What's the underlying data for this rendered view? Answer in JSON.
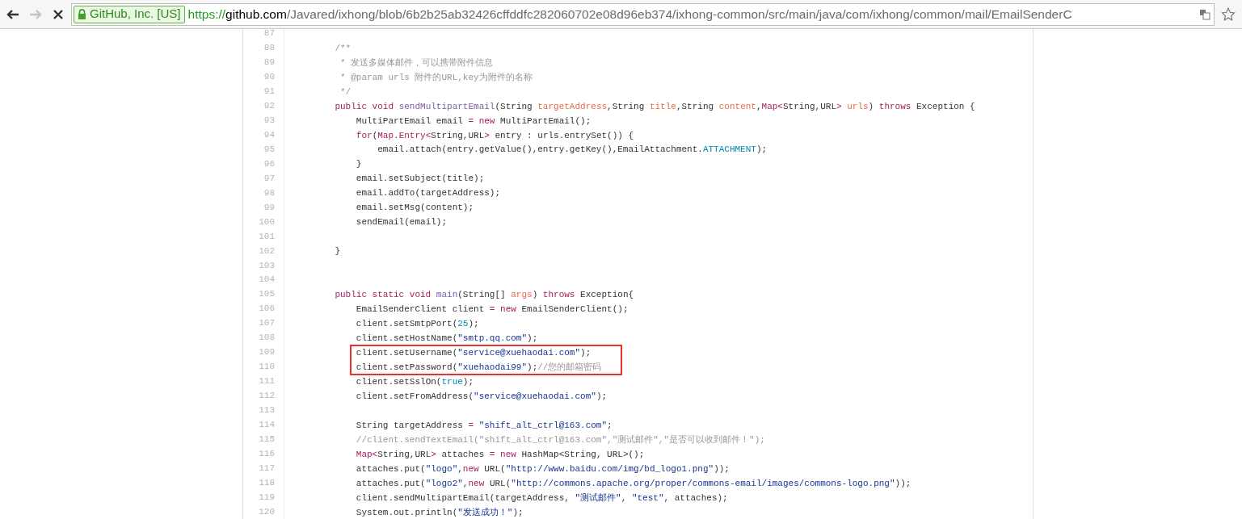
{
  "browser": {
    "back_disabled": false,
    "forward_disabled": true,
    "security_label": "GitHub, Inc. [US]",
    "url": [
      {
        "kind": "scheme",
        "text": "https://"
      },
      {
        "kind": "host",
        "text": "github.com"
      },
      {
        "kind": "path",
        "text": "/Javared/ixhong/blob/6b2b25ab32426cffddfc282060702e08d96eb374/ixhong-common/src/main/java/com/ixhong/common/mail/EmailSenderC"
      }
    ]
  },
  "code": {
    "lines": [
      {
        "number": "87",
        "boxed": false
      },
      {
        "number": "88",
        "boxed": false,
        "tokens": [
          {
            "kind": "comment",
            "text": "    /**"
          }
        ]
      },
      {
        "number": "89",
        "boxed": false,
        "tokens": [
          {
            "kind": "comment",
            "text": "     * 发送多媒体邮件，可以携带附件信息"
          }
        ]
      },
      {
        "number": "90",
        "boxed": false,
        "tokens": [
          {
            "kind": "comment",
            "text": "     * @param urls 附件的URL,key为附件的名称"
          }
        ]
      },
      {
        "number": "91",
        "boxed": false,
        "tokens": [
          {
            "kind": "comment",
            "text": "     */"
          }
        ]
      },
      {
        "number": "92",
        "boxed": false,
        "tokens": [
          {
            "kind": "keyword",
            "text": "    public"
          },
          {
            "kind": "keyword",
            "text": " void "
          },
          {
            "kind": "function",
            "text": "sendMultipartEmail"
          },
          {
            "kind": "plain",
            "text": "(String "
          },
          {
            "kind": "param",
            "text": "targetAddress"
          },
          {
            "kind": "plain",
            "text": ",String "
          },
          {
            "kind": "param",
            "text": "title"
          },
          {
            "kind": "plain",
            "text": ",String "
          },
          {
            "kind": "param",
            "text": "content"
          },
          {
            "kind": "plain",
            "text": ","
          },
          {
            "kind": "keyword",
            "text": "Map<"
          },
          {
            "kind": "plain",
            "text": "String,URL"
          },
          {
            "kind": "keyword",
            "text": ">"
          },
          {
            "kind": "param",
            "text": " urls"
          },
          {
            "kind": "plain",
            "text": ") "
          },
          {
            "kind": "keyword",
            "text": "throws"
          },
          {
            "kind": "plain",
            "text": " Exception {"
          }
        ]
      },
      {
        "number": "93",
        "boxed": false,
        "tokens": [
          {
            "kind": "plain",
            "text": "        MultiPartEmail email "
          },
          {
            "kind": "keyword",
            "text": "= new"
          },
          {
            "kind": "plain",
            "text": " MultiPartEmail();"
          }
        ]
      },
      {
        "number": "94",
        "boxed": false,
        "tokens": [
          {
            "kind": "keyword",
            "text": "        for"
          },
          {
            "kind": "plain",
            "text": "("
          },
          {
            "kind": "keyword",
            "text": "Map.Entry<"
          },
          {
            "kind": "plain",
            "text": "String,URL"
          },
          {
            "kind": "keyword",
            "text": ">"
          },
          {
            "kind": "plain",
            "text": " entry : urls.entrySet()) {"
          }
        ]
      },
      {
        "number": "95",
        "boxed": false,
        "tokens": [
          {
            "kind": "plain",
            "text": "            email.attach(entry.getValue(),entry.getKey(),EmailAttachment."
          },
          {
            "kind": "constant",
            "text": "ATTACHMENT"
          },
          {
            "kind": "plain",
            "text": ");"
          }
        ]
      },
      {
        "number": "96",
        "boxed": false,
        "tokens": [
          {
            "kind": "plain",
            "text": "        }"
          }
        ]
      },
      {
        "number": "97",
        "boxed": false,
        "tokens": [
          {
            "kind": "plain",
            "text": "        email.setSubject(title);"
          }
        ]
      },
      {
        "number": "98",
        "boxed": false,
        "tokens": [
          {
            "kind": "plain",
            "text": "        email.addTo(targetAddress);"
          }
        ]
      },
      {
        "number": "99",
        "boxed": false,
        "tokens": [
          {
            "kind": "plain",
            "text": "        email.setMsg(content);"
          }
        ]
      },
      {
        "number": "100",
        "boxed": false,
        "tokens": [
          {
            "kind": "plain",
            "text": "        sendEmail(email);"
          }
        ]
      },
      {
        "number": "101",
        "boxed": false
      },
      {
        "number": "102",
        "boxed": false,
        "tokens": [
          {
            "kind": "plain",
            "text": "    }"
          }
        ]
      },
      {
        "number": "103",
        "boxed": false
      },
      {
        "number": "104",
        "boxed": false
      },
      {
        "number": "105",
        "boxed": false,
        "tokens": [
          {
            "kind": "keyword",
            "text": "    public static void "
          },
          {
            "kind": "function",
            "text": "main"
          },
          {
            "kind": "plain",
            "text": "(String[] "
          },
          {
            "kind": "param",
            "text": "args"
          },
          {
            "kind": "plain",
            "text": ") "
          },
          {
            "kind": "keyword",
            "text": "throws"
          },
          {
            "kind": "plain",
            "text": " Exception{"
          }
        ]
      },
      {
        "number": "106",
        "boxed": false,
        "tokens": [
          {
            "kind": "plain",
            "text": "        EmailSenderClient client "
          },
          {
            "kind": "keyword",
            "text": "= new"
          },
          {
            "kind": "plain",
            "text": " EmailSenderClient();"
          }
        ]
      },
      {
        "number": "107",
        "boxed": false,
        "tokens": [
          {
            "kind": "plain",
            "text": "        client.setSmtpPort("
          },
          {
            "kind": "constant",
            "text": "25"
          },
          {
            "kind": "plain",
            "text": ");"
          }
        ]
      },
      {
        "number": "108",
        "boxed": false,
        "tokens": [
          {
            "kind": "plain",
            "text": "        client.setHostName("
          },
          {
            "kind": "string",
            "text": "\"smtp.qq.com\""
          },
          {
            "kind": "plain",
            "text": ");"
          }
        ]
      },
      {
        "number": "109",
        "boxed": true,
        "tokens": [
          {
            "kind": "plain",
            "text": "        client.setUsername("
          },
          {
            "kind": "string",
            "text": "\"service@xuehaodai.com\""
          },
          {
            "kind": "plain",
            "text": ");"
          }
        ]
      },
      {
        "number": "110",
        "boxed": true,
        "tokens": [
          {
            "kind": "plain",
            "text": "        client.setPassword("
          },
          {
            "kind": "string",
            "text": "\"xuehaodai99\""
          },
          {
            "kind": "plain",
            "text": ");"
          },
          {
            "kind": "comment",
            "text": "//您的邮箱密码"
          }
        ]
      },
      {
        "number": "111",
        "boxed": false,
        "tokens": [
          {
            "kind": "plain",
            "text": "        client.setSslOn("
          },
          {
            "kind": "constant",
            "text": "true"
          },
          {
            "kind": "plain",
            "text": ");"
          }
        ]
      },
      {
        "number": "112",
        "boxed": false,
        "tokens": [
          {
            "kind": "plain",
            "text": "        client.setFromAddress("
          },
          {
            "kind": "string",
            "text": "\"service@xuehaodai.com\""
          },
          {
            "kind": "plain",
            "text": ");"
          }
        ]
      },
      {
        "number": "113",
        "boxed": false
      },
      {
        "number": "114",
        "boxed": false,
        "tokens": [
          {
            "kind": "plain",
            "text": "        String targetAddress "
          },
          {
            "kind": "keyword",
            "text": "= "
          },
          {
            "kind": "string",
            "text": "\"shift_alt_ctrl@163.com\""
          },
          {
            "kind": "plain",
            "text": ";"
          }
        ]
      },
      {
        "number": "115",
        "boxed": false,
        "tokens": [
          {
            "kind": "comment",
            "text": "        //client.sendTextEmail(\"shift_alt_ctrl@163.com\",\"测试邮件\",\"是否可以收到邮件！\");"
          }
        ]
      },
      {
        "number": "116",
        "boxed": false,
        "tokens": [
          {
            "kind": "keyword",
            "text": "        Map<"
          },
          {
            "kind": "plain",
            "text": "String,URL"
          },
          {
            "kind": "keyword",
            "text": ">"
          },
          {
            "kind": "plain",
            "text": " attaches "
          },
          {
            "kind": "keyword",
            "text": "= new"
          },
          {
            "kind": "plain",
            "text": " HashMap<String, URL>();"
          }
        ]
      },
      {
        "number": "117",
        "boxed": false,
        "tokens": [
          {
            "kind": "plain",
            "text": "        attaches.put("
          },
          {
            "kind": "string",
            "text": "\"logo\""
          },
          {
            "kind": "plain",
            "text": ","
          },
          {
            "kind": "keyword",
            "text": "new"
          },
          {
            "kind": "plain",
            "text": " URL("
          },
          {
            "kind": "string",
            "text": "\"http://www.baidu.com/img/bd_logo1.png\""
          },
          {
            "kind": "plain",
            "text": "));"
          }
        ]
      },
      {
        "number": "118",
        "boxed": false,
        "tokens": [
          {
            "kind": "plain",
            "text": "        attaches.put("
          },
          {
            "kind": "string",
            "text": "\"logo2\""
          },
          {
            "kind": "plain",
            "text": ","
          },
          {
            "kind": "keyword",
            "text": "new"
          },
          {
            "kind": "plain",
            "text": " URL("
          },
          {
            "kind": "string",
            "text": "\"http://commons.apache.org/proper/commons-email/images/commons-logo.png\""
          },
          {
            "kind": "plain",
            "text": "));"
          }
        ]
      },
      {
        "number": "119",
        "boxed": false,
        "tokens": [
          {
            "kind": "plain",
            "text": "        client.sendMultipartEmail(targetAddress, "
          },
          {
            "kind": "string",
            "text": "\"测试邮件\""
          },
          {
            "kind": "plain",
            "text": ", "
          },
          {
            "kind": "string",
            "text": "\"test\""
          },
          {
            "kind": "plain",
            "text": ", attaches);"
          }
        ]
      },
      {
        "number": "120",
        "boxed": false,
        "tokens": [
          {
            "kind": "plain",
            "text": "        System.out.println("
          },
          {
            "kind": "string",
            "text": "\"发送成功！\""
          },
          {
            "kind": "plain",
            "text": ");"
          }
        ]
      }
    ]
  }
}
